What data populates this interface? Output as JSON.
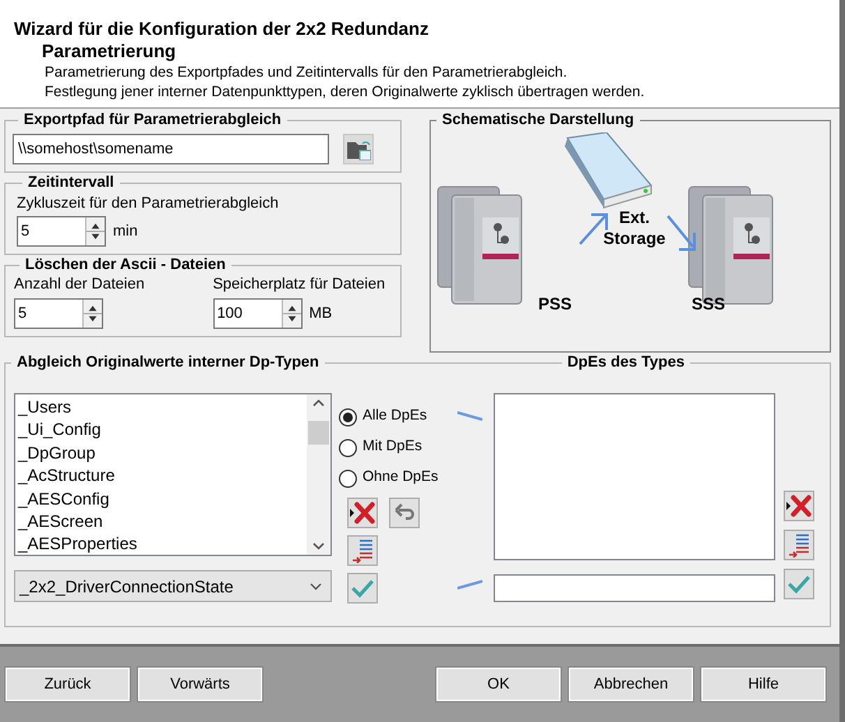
{
  "header": {
    "title": "Wizard für die Konfiguration der 2x2 Redundanz",
    "subtitle": "Parametrierung",
    "description": [
      "Parametrierung des Exportpfades und Zeitintervalls für den Parametrierabgleich.",
      "Festlegung jener interner Datenpunkttypen, deren Originalwerte zyklisch übertragen werden."
    ]
  },
  "export_group": {
    "legend": "Exportpfad für Parametrierabgleich",
    "path": "\\\\somehost\\somename"
  },
  "time_group": {
    "legend": "Zeitintervall",
    "label": "Zykluszeit für den Parametrierabgleich",
    "value": "5",
    "unit": "min"
  },
  "delete_group": {
    "legend": "Löschen der Ascii - Dateien",
    "fields": [
      {
        "label": "Anzahl der Dateien",
        "value": "5"
      },
      {
        "label": "Speicherplatz für Dateien",
        "value": "100",
        "unit": "MB"
      }
    ]
  },
  "schematic": {
    "legend": "Schematische Darstellung",
    "storage_label": "Ext. Storage",
    "primary_label": "PSS",
    "secondary_label": "SSS"
  },
  "types_group": {
    "legend": "Abgleich Originalwerte interner Dp-Typen",
    "types": [
      "_Users",
      "_Ui_Config",
      "_DpGroup",
      "_AcStructure",
      "_AESConfig",
      "_AEScreen",
      "_AESProperties"
    ],
    "selected_type": "_2x2_DriverConnectionState",
    "filters": [
      {
        "label": "Alle DpEs",
        "selected": true
      },
      {
        "label": "Mit DpEs",
        "selected": false
      },
      {
        "label": "Ohne DpEs",
        "selected": false
      }
    ]
  },
  "dpes_group": {
    "legend": "DpEs des Types"
  },
  "nav_buttons": [
    "Zurück",
    "Vorwärts"
  ],
  "dialog_buttons": [
    "OK",
    "Abbrechen",
    "Hilfe"
  ]
}
